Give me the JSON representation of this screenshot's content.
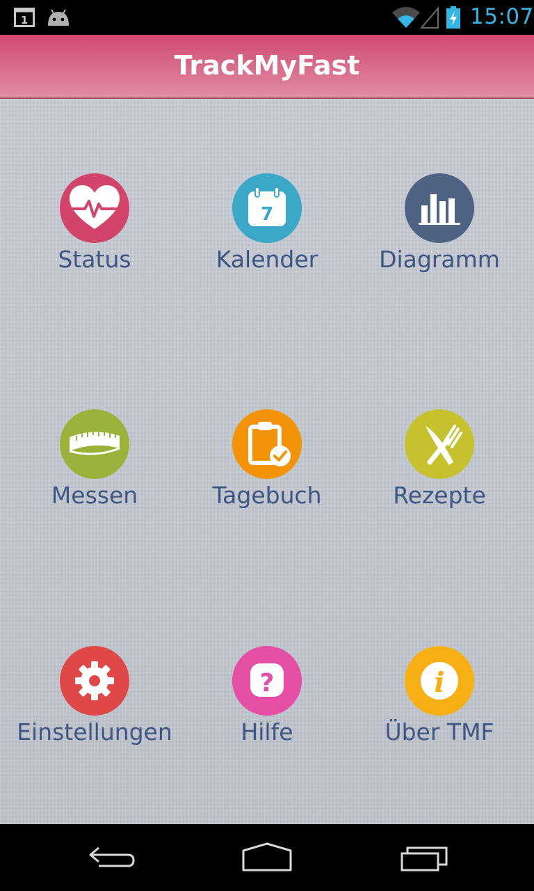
{
  "status_bar": {
    "time": "15:07",
    "calendar_day": "1",
    "icons": [
      "calendar-notification-icon",
      "android-icon",
      "wifi-icon",
      "signal-icon",
      "battery-charging-icon"
    ],
    "time_color": "#33b5e5"
  },
  "app_bar": {
    "title": "TrackMyFast",
    "color": "#d6577a"
  },
  "menu": {
    "items": [
      {
        "label": "Status",
        "icon": "heart-pulse-icon",
        "color": "#d24469"
      },
      {
        "label": "Kalender",
        "icon": "calendar-icon",
        "color": "#3aa8c6",
        "calendar_day": "7"
      },
      {
        "label": "Diagramm",
        "icon": "bar-chart-icon",
        "color": "#4e6384"
      },
      {
        "label": "Messen",
        "icon": "measuring-tape-icon",
        "color": "#9bb23a"
      },
      {
        "label": "Tagebuch",
        "icon": "clipboard-check-icon",
        "color": "#f39408"
      },
      {
        "label": "Rezepte",
        "icon": "fork-knife-icon",
        "color": "#c5c22e"
      },
      {
        "label": "Einstellungen",
        "icon": "gear-icon",
        "color": "#e04848"
      },
      {
        "label": "Hilfe",
        "icon": "question-icon",
        "color": "#e44ea5"
      },
      {
        "label": "Über TMF",
        "icon": "info-icon",
        "color": "#f7b014"
      }
    ]
  },
  "nav_bar": {
    "buttons": [
      "back-icon",
      "home-icon",
      "recent-apps-icon"
    ]
  }
}
